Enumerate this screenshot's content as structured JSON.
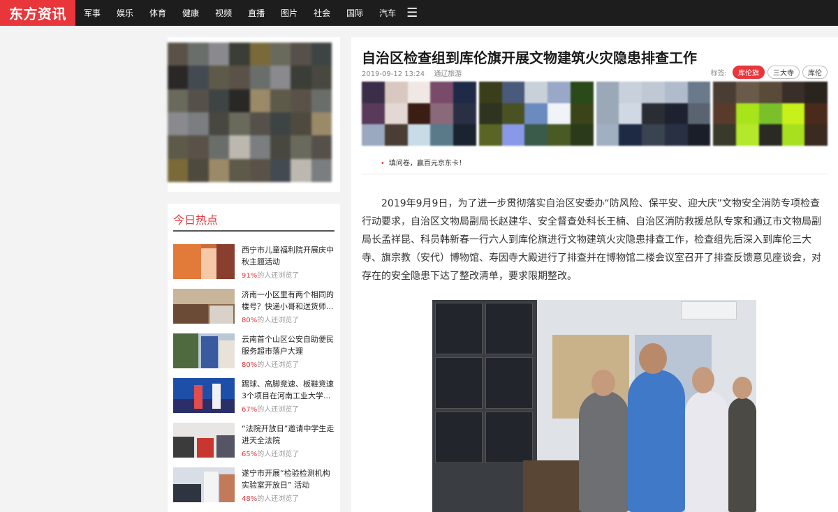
{
  "nav": {
    "logo": "东方资讯",
    "items": [
      "军事",
      "娱乐",
      "体育",
      "健康",
      "视频",
      "直播",
      "图片",
      "社会",
      "国际",
      "汽车"
    ],
    "menu_icon": "☰"
  },
  "hot": {
    "title": "今日热点",
    "suffix": "的人还浏览了",
    "items": [
      {
        "headline": "西宁市儿童福利院开展庆中秋主题活动",
        "pct": "91%"
      },
      {
        "headline": "济南一小区里有两个相同的楼号？快递小哥和送货师...",
        "pct": "80%"
      },
      {
        "headline": "云南首个山区公安自助便民服务超市落户大理",
        "pct": "80%"
      },
      {
        "headline": "踢球、高脚竞速、板鞋竞速3个项目在河南工业大学...",
        "pct": "67%"
      },
      {
        "headline": "“法院开放日”邀请中学生走进天全法院",
        "pct": "65%"
      },
      {
        "headline": "遂宁市开展“检验检测机构实验室开放日” 活动",
        "pct": "48%"
      }
    ]
  },
  "article": {
    "title": "自治区检查组到库伦旗开展文物建筑火灾隐患排查工作",
    "date": "2019-09-12 13:24",
    "source": "通辽旅游",
    "tags_label": "标签:",
    "tags": [
      "库伦旗",
      "三大寺",
      "库伦"
    ],
    "promo": "填问卷，赢百元京东卡！",
    "body": "2019年9月9日，为了进一步贯彻落实自治区安委办“防风险、保平安、迎大庆”文物安全消防专项检查行动要求，自治区文物局副局长赵建华、安全督查处科长王楠、自治区消防救援总队专家和通辽市文物局副局长孟祥昆、科员韩新春一行六人到库伦旗进行文物建筑火灾隐患排查工作，检查组先后深入到库伦三大寺、旗宗教（安代）博物馆、寿因寺大殿进行了排查并在博物馆二楼会议室召开了排查反馈意见座谈会，对存在的安全隐患下达了整改清单，要求限期整改。"
  },
  "colors": {
    "accent": "#e8363b",
    "nav_bg": "#1d1d1d",
    "page_bg": "#f3f3f3"
  }
}
